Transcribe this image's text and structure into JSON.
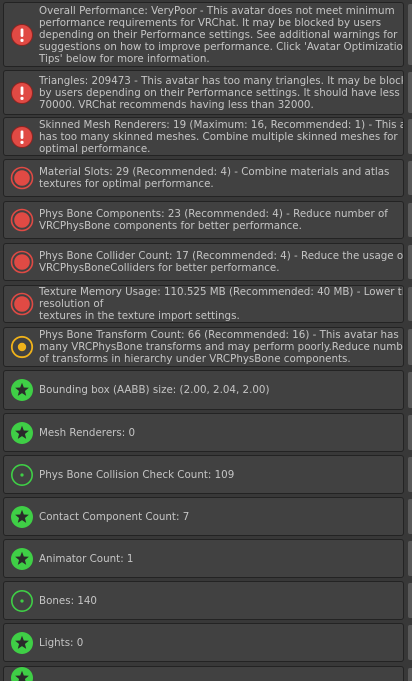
{
  "colors": {
    "error": "#e04a44",
    "warning": "#f0b21a",
    "info": "#3fcf46"
  },
  "messages": [
    {
      "severity": "error",
      "icon": "exclamation-icon",
      "text": "Overall Performance: VeryPoor - This avatar does not meet minimum\nperformance requirements for VRChat. It may be blocked by users\ndepending on their Performance settings. See additional warnings for\nsuggestions on how to improve performance. Click 'Avatar Optimization\nTips' below for more information."
    },
    {
      "severity": "error",
      "icon": "exclamation-icon",
      "text": "Triangles: 209473 - This avatar has too many triangles. It may be blocked\nby users depending on their Performance settings. It should have less than\n70000. VRChat recommends having less than 32000."
    },
    {
      "severity": "error",
      "icon": "exclamation-icon",
      "text": "Skinned Mesh Renderers: 19 (Maximum: 16, Recommended: 1) - This avatar\nhas too many skinned meshes. Combine multiple skinned meshes for\noptimal performance."
    },
    {
      "severity": "poor",
      "icon": "red-circle-icon",
      "text": "Material Slots: 29 (Recommended: 4) - Combine materials and atlas\ntextures for optimal performance."
    },
    {
      "severity": "poor",
      "icon": "red-circle-icon",
      "text": "Phys Bone Components: 23 (Recommended: 4) - Reduce number of\nVRCPhysBone components for better performance."
    },
    {
      "severity": "poor",
      "icon": "red-circle-icon",
      "text": "Phys Bone Collider Count: 17 (Recommended: 4) - Reduce the usage of\nVRCPhysBoneColliders for better performance."
    },
    {
      "severity": "poor",
      "icon": "red-circle-icon",
      "text": "Texture Memory Usage: 110.525 MB (Recommended: 40 MB) - Lower the resolution of\ntextures in the texture import settings."
    },
    {
      "severity": "medium",
      "icon": "yellow-ring-icon",
      "text": "Phys Bone Transform Count: 66 (Recommended: 16) - This avatar has\nmany VRCPhysBone transforms and may perform poorly.Reduce number\nof transforms in hierarchy under VRCPhysBone components."
    },
    {
      "severity": "excellent",
      "icon": "star-icon",
      "text": "Bounding box (AABB) size: (2.00, 2.04, 2.00)"
    },
    {
      "severity": "excellent",
      "icon": "star-icon",
      "text": "Mesh Renderers: 0"
    },
    {
      "severity": "good",
      "icon": "dot-ring-icon",
      "text": "Phys Bone Collision Check Count: 109"
    },
    {
      "severity": "excellent",
      "icon": "star-icon",
      "text": "Contact Component Count: 7"
    },
    {
      "severity": "excellent",
      "icon": "star-icon",
      "text": "Animator Count: 1"
    },
    {
      "severity": "good",
      "icon": "dot-ring-icon",
      "text": "Bones: 140"
    },
    {
      "severity": "excellent",
      "icon": "star-icon",
      "text": "Lights: 0"
    },
    {
      "severity": "excellent",
      "icon": "star-icon",
      "text": ""
    }
  ]
}
